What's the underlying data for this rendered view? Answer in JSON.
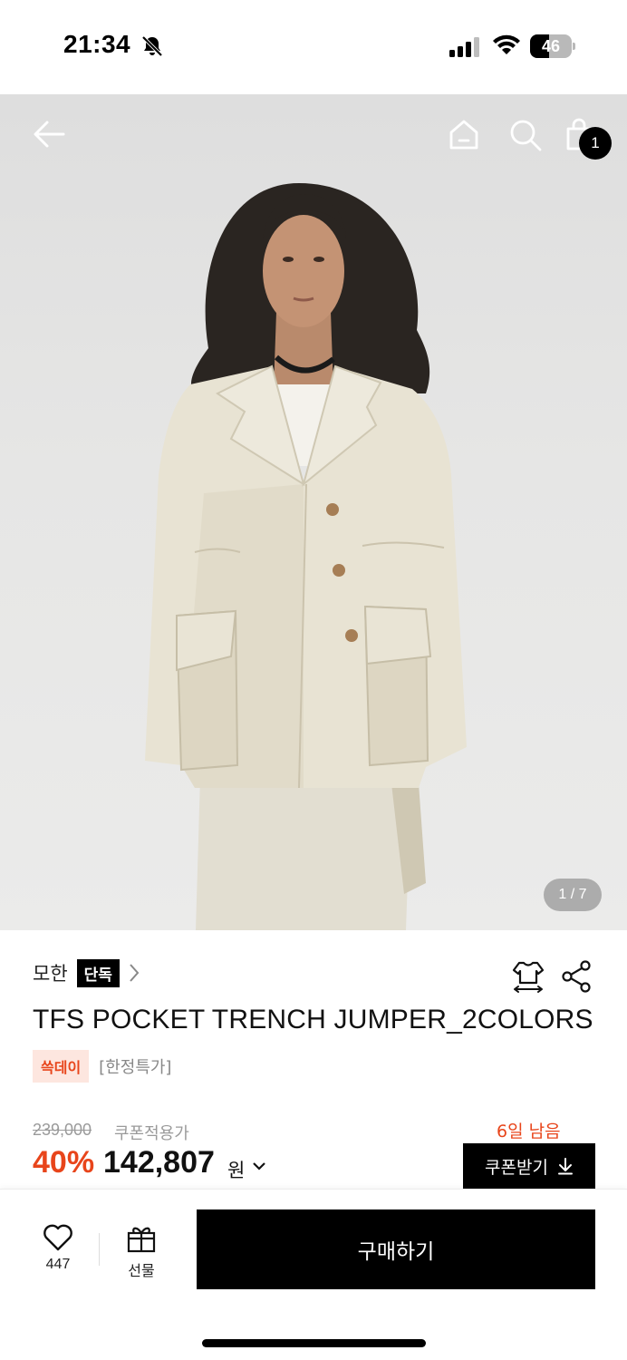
{
  "status_bar": {
    "time": "21:34",
    "battery_level": "46",
    "battery_fraction": 0.46
  },
  "hero": {
    "cart_count": "1",
    "page_indicator": "1 / 7",
    "icons": [
      "back-arrow-icon",
      "home-icon",
      "search-icon",
      "shopping-bag-icon"
    ]
  },
  "product": {
    "brand": "모한",
    "exclusive_badge": "단독",
    "title": "TFS POCKET TRENCH JUMPER_2COLORS",
    "event_tag": "쓱데이",
    "limited_tag": "[한정특가]",
    "original_price": "239,000",
    "coupon_applied_label": "쿠폰적용가",
    "discount_rate": "40%",
    "sale_price": "142,807",
    "currency": "원",
    "days_left": "6일 남음",
    "coupon_button_label": "쿠폰받기"
  },
  "bottom_bar": {
    "like_count": "447",
    "gift_label": "선물",
    "buy_label": "구매하기"
  },
  "colors": {
    "accent": "#e8451b",
    "event_tag_bg": "#fde6df",
    "primary_button": "#000000"
  }
}
